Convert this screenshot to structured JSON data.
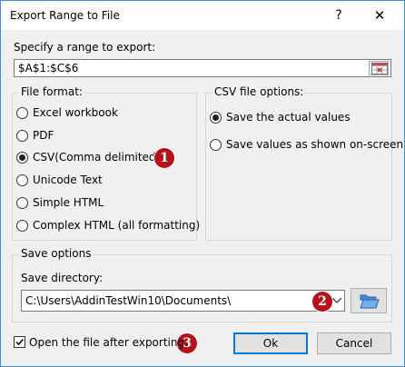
{
  "window": {
    "title": "Export Range to File",
    "help_glyph": "?",
    "close_glyph": "✕"
  },
  "range": {
    "label": "Specify a range to export:",
    "value": "$A$1:$C$6",
    "picker_icon": "range-select-icon"
  },
  "file_format": {
    "title": "File format:",
    "options": [
      {
        "label": "Excel workbook",
        "selected": false
      },
      {
        "label": "PDF",
        "selected": false
      },
      {
        "label": "CSV(Comma delimited)",
        "selected": true
      },
      {
        "label": "Unicode Text",
        "selected": false
      },
      {
        "label": "Simple HTML",
        "selected": false
      },
      {
        "label": "Complex HTML (all formatting)",
        "selected": false
      }
    ]
  },
  "csv_options": {
    "title": "CSV file options:",
    "options": [
      {
        "label": "Save the actual values",
        "selected": true
      },
      {
        "label": "Save values as shown on-screen",
        "selected": false
      }
    ]
  },
  "save_options": {
    "title": "Save options",
    "directory_label": "Save directory:",
    "directory_value": "C:\\Users\\AddinTestWin10\\Documents\\",
    "folder_icon": "folder-open-icon"
  },
  "open_after": {
    "label": "Open the file after exporting.",
    "checked": true
  },
  "buttons": {
    "ok": "Ok",
    "cancel": "Cancel"
  },
  "badges": {
    "b1": "1",
    "b2": "2",
    "b3": "3"
  },
  "colors": {
    "badge": "#b5121b",
    "accent_border": "#0078d7"
  }
}
